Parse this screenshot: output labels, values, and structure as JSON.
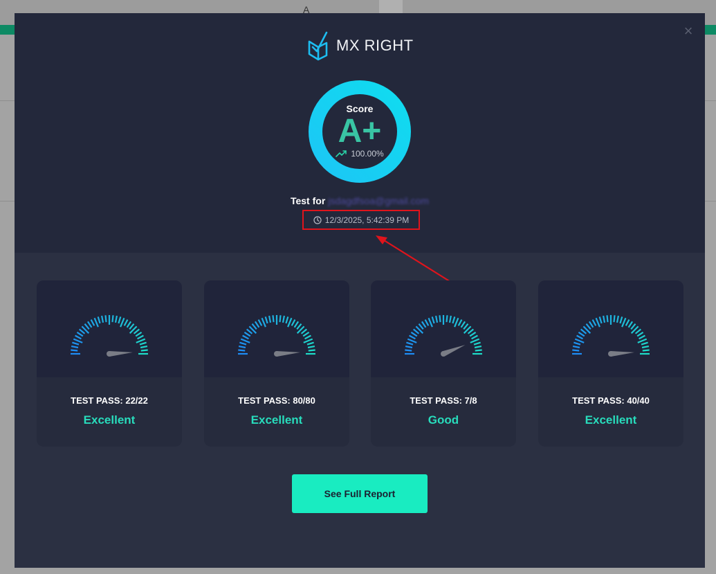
{
  "background": {
    "column_letter": "A"
  },
  "modal": {
    "close_icon": "close-icon",
    "logo": {
      "text": "MX RIGHT",
      "icon": "mx-right-checkmark-icon"
    },
    "score": {
      "label": "Score",
      "grade": "A+",
      "percentage": "100.00%",
      "trend_icon": "trend-up-icon",
      "ring_fraction": 1.0
    },
    "test_for": {
      "label": "Test for",
      "email": "jsdagdfsoa@gmail.com"
    },
    "timestamp": {
      "icon": "clock-icon",
      "value": "12/3/2025, 5:42:39 PM"
    },
    "cards": [
      {
        "pass": "TEST PASS: 22/22",
        "rating": "Excellent",
        "level": 1.0
      },
      {
        "pass": "TEST PASS: 80/80",
        "rating": "Excellent",
        "level": 1.0
      },
      {
        "pass": "TEST PASS: 7/8",
        "rating": "Good",
        "level": 0.875
      },
      {
        "pass": "TEST PASS: 40/40",
        "rating": "Excellent",
        "level": 1.0
      }
    ],
    "report_button": "See Full Report"
  },
  "colors": {
    "accent": "#19ecc1",
    "grade": "#39c5a4",
    "rating": "#28dcbc",
    "annotation": "#e0141c"
  }
}
